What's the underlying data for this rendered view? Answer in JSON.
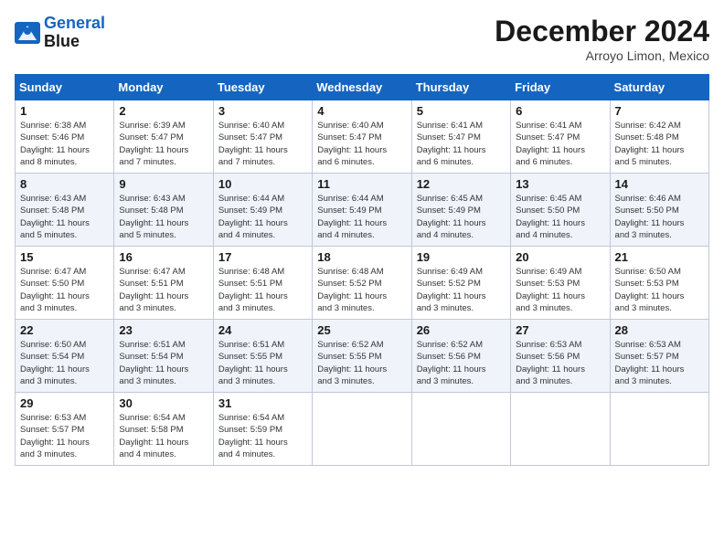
{
  "header": {
    "logo_line1": "General",
    "logo_line2": "Blue",
    "month_title": "December 2024",
    "location": "Arroyo Limon, Mexico"
  },
  "weekdays": [
    "Sunday",
    "Monday",
    "Tuesday",
    "Wednesday",
    "Thursday",
    "Friday",
    "Saturday"
  ],
  "weeks": [
    [
      {
        "day": "1",
        "info": "Sunrise: 6:38 AM\nSunset: 5:46 PM\nDaylight: 11 hours\nand 8 minutes."
      },
      {
        "day": "2",
        "info": "Sunrise: 6:39 AM\nSunset: 5:47 PM\nDaylight: 11 hours\nand 7 minutes."
      },
      {
        "day": "3",
        "info": "Sunrise: 6:40 AM\nSunset: 5:47 PM\nDaylight: 11 hours\nand 7 minutes."
      },
      {
        "day": "4",
        "info": "Sunrise: 6:40 AM\nSunset: 5:47 PM\nDaylight: 11 hours\nand 6 minutes."
      },
      {
        "day": "5",
        "info": "Sunrise: 6:41 AM\nSunset: 5:47 PM\nDaylight: 11 hours\nand 6 minutes."
      },
      {
        "day": "6",
        "info": "Sunrise: 6:41 AM\nSunset: 5:47 PM\nDaylight: 11 hours\nand 6 minutes."
      },
      {
        "day": "7",
        "info": "Sunrise: 6:42 AM\nSunset: 5:48 PM\nDaylight: 11 hours\nand 5 minutes."
      }
    ],
    [
      {
        "day": "8",
        "info": "Sunrise: 6:43 AM\nSunset: 5:48 PM\nDaylight: 11 hours\nand 5 minutes."
      },
      {
        "day": "9",
        "info": "Sunrise: 6:43 AM\nSunset: 5:48 PM\nDaylight: 11 hours\nand 5 minutes."
      },
      {
        "day": "10",
        "info": "Sunrise: 6:44 AM\nSunset: 5:49 PM\nDaylight: 11 hours\nand 4 minutes."
      },
      {
        "day": "11",
        "info": "Sunrise: 6:44 AM\nSunset: 5:49 PM\nDaylight: 11 hours\nand 4 minutes."
      },
      {
        "day": "12",
        "info": "Sunrise: 6:45 AM\nSunset: 5:49 PM\nDaylight: 11 hours\nand 4 minutes."
      },
      {
        "day": "13",
        "info": "Sunrise: 6:45 AM\nSunset: 5:50 PM\nDaylight: 11 hours\nand 4 minutes."
      },
      {
        "day": "14",
        "info": "Sunrise: 6:46 AM\nSunset: 5:50 PM\nDaylight: 11 hours\nand 3 minutes."
      }
    ],
    [
      {
        "day": "15",
        "info": "Sunrise: 6:47 AM\nSunset: 5:50 PM\nDaylight: 11 hours\nand 3 minutes."
      },
      {
        "day": "16",
        "info": "Sunrise: 6:47 AM\nSunset: 5:51 PM\nDaylight: 11 hours\nand 3 minutes."
      },
      {
        "day": "17",
        "info": "Sunrise: 6:48 AM\nSunset: 5:51 PM\nDaylight: 11 hours\nand 3 minutes."
      },
      {
        "day": "18",
        "info": "Sunrise: 6:48 AM\nSunset: 5:52 PM\nDaylight: 11 hours\nand 3 minutes."
      },
      {
        "day": "19",
        "info": "Sunrise: 6:49 AM\nSunset: 5:52 PM\nDaylight: 11 hours\nand 3 minutes."
      },
      {
        "day": "20",
        "info": "Sunrise: 6:49 AM\nSunset: 5:53 PM\nDaylight: 11 hours\nand 3 minutes."
      },
      {
        "day": "21",
        "info": "Sunrise: 6:50 AM\nSunset: 5:53 PM\nDaylight: 11 hours\nand 3 minutes."
      }
    ],
    [
      {
        "day": "22",
        "info": "Sunrise: 6:50 AM\nSunset: 5:54 PM\nDaylight: 11 hours\nand 3 minutes."
      },
      {
        "day": "23",
        "info": "Sunrise: 6:51 AM\nSunset: 5:54 PM\nDaylight: 11 hours\nand 3 minutes."
      },
      {
        "day": "24",
        "info": "Sunrise: 6:51 AM\nSunset: 5:55 PM\nDaylight: 11 hours\nand 3 minutes."
      },
      {
        "day": "25",
        "info": "Sunrise: 6:52 AM\nSunset: 5:55 PM\nDaylight: 11 hours\nand 3 minutes."
      },
      {
        "day": "26",
        "info": "Sunrise: 6:52 AM\nSunset: 5:56 PM\nDaylight: 11 hours\nand 3 minutes."
      },
      {
        "day": "27",
        "info": "Sunrise: 6:53 AM\nSunset: 5:56 PM\nDaylight: 11 hours\nand 3 minutes."
      },
      {
        "day": "28",
        "info": "Sunrise: 6:53 AM\nSunset: 5:57 PM\nDaylight: 11 hours\nand 3 minutes."
      }
    ],
    [
      {
        "day": "29",
        "info": "Sunrise: 6:53 AM\nSunset: 5:57 PM\nDaylight: 11 hours\nand 3 minutes."
      },
      {
        "day": "30",
        "info": "Sunrise: 6:54 AM\nSunset: 5:58 PM\nDaylight: 11 hours\nand 4 minutes."
      },
      {
        "day": "31",
        "info": "Sunrise: 6:54 AM\nSunset: 5:59 PM\nDaylight: 11 hours\nand 4 minutes."
      },
      null,
      null,
      null,
      null
    ]
  ]
}
